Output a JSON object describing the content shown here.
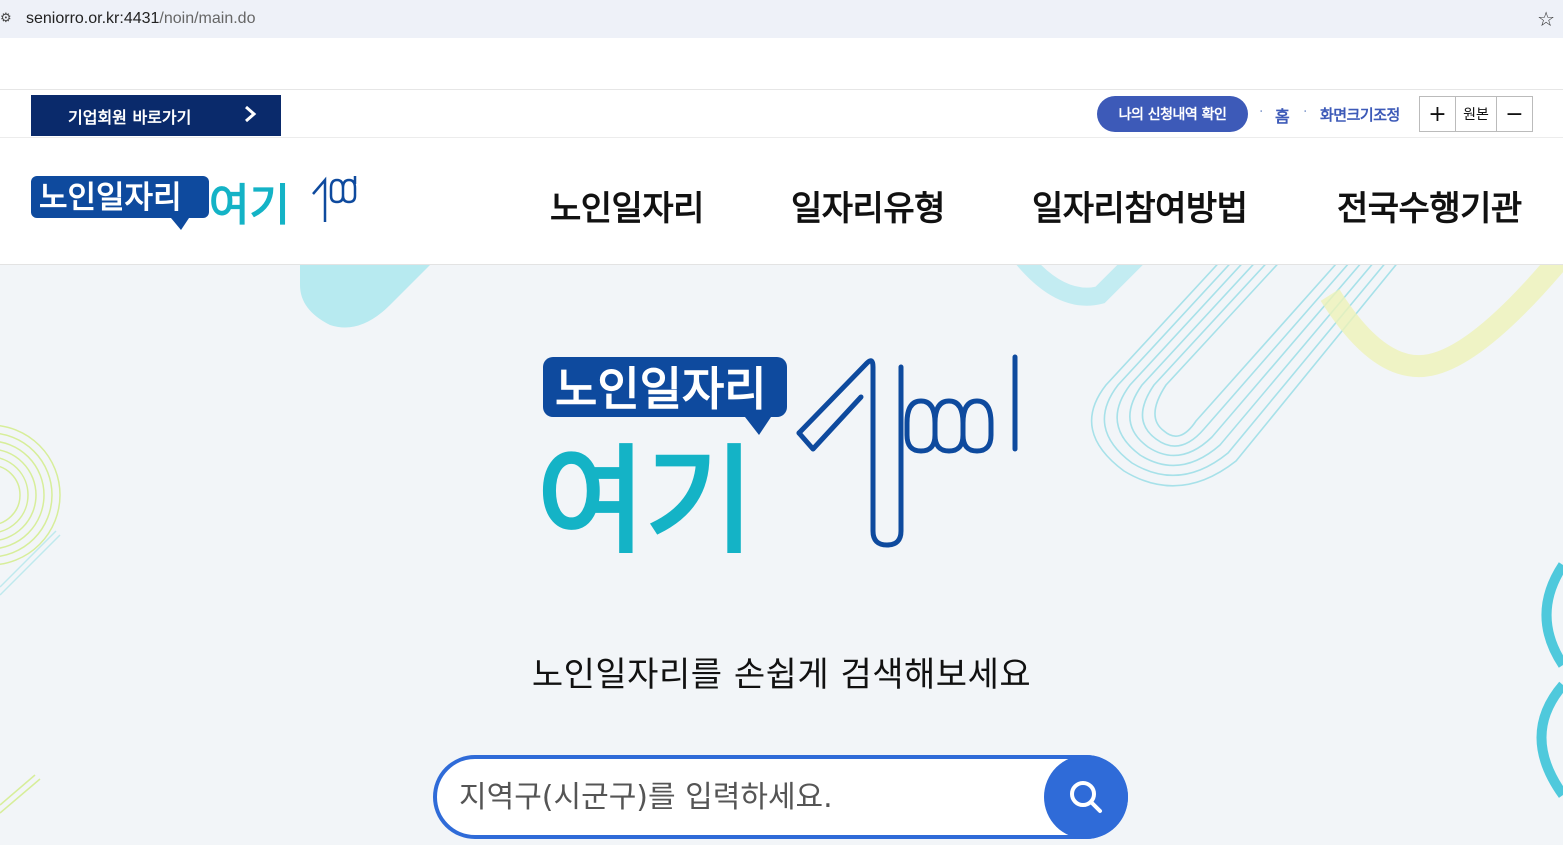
{
  "browser": {
    "url_host": "seniorro.or.kr:4431",
    "url_path": "/noin/main.do"
  },
  "util": {
    "biz_button": "기업회원 바로가기",
    "apply_button": "나의 신청내역 확인",
    "home": "홈",
    "zoom_label": "화면크기조정",
    "zoom_plus": "+",
    "zoom_original": "원본",
    "zoom_minus": "−"
  },
  "logo": {
    "main_text": "노인일자리",
    "sub_text": "여기"
  },
  "nav": {
    "items": [
      "노인일자리",
      "일자리유형",
      "일자리참여방법",
      "전국수행기관"
    ]
  },
  "hero": {
    "title": "노인일자리를 손쉽게 검색해보세요",
    "search_placeholder": "지역구(시군구)를 입력하세요."
  },
  "colors": {
    "navy": "#0a2a6b",
    "blue": "#3d5ab8",
    "search_blue": "#2f6bd8",
    "teal": "#14b3c6",
    "logo_navy": "#0e4a9e"
  }
}
